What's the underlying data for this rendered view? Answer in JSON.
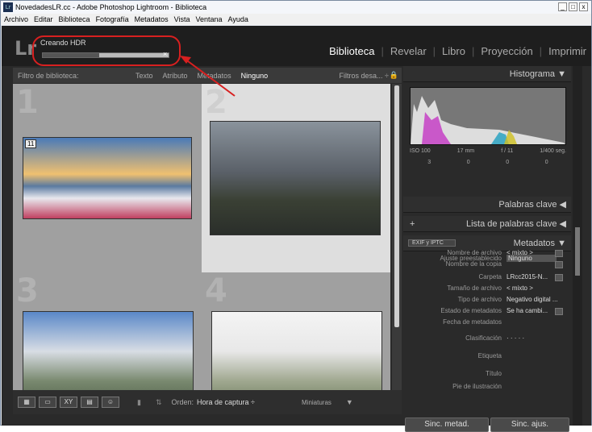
{
  "window": {
    "title": "NovedadesLR.cc - Adobe Photoshop Lightroom - Biblioteca",
    "icon": "Lr",
    "controls": [
      "_",
      "□",
      "x"
    ]
  },
  "menu": [
    "Archivo",
    "Editar",
    "Biblioteca",
    "Fotografía",
    "Metadatos",
    "Vista",
    "Ventana",
    "Ayuda"
  ],
  "logo": "Lr",
  "progress": {
    "label": "Creando HDR",
    "fraction": 0.45,
    "close": "×"
  },
  "modules": [
    "Biblioteca",
    "Revelar",
    "Libro",
    "Proyección",
    "Imprimir"
  ],
  "filter": {
    "label": "Filtro de biblioteca:",
    "items": [
      "Texto",
      "Atributo",
      "Metadatos",
      "Ninguno"
    ],
    "preset": "Filtros desa... ÷"
  },
  "grid": {
    "cells": [
      {
        "num": "1",
        "badge": "11"
      },
      {
        "num": "2",
        "badge": ""
      },
      {
        "num": "3",
        "badge": ""
      },
      {
        "num": "4",
        "badge": ""
      }
    ]
  },
  "toolbar": {
    "sort_label": "Orden:",
    "sort_value": "Hora de captura ÷",
    "thumb_label": "Miniaturas",
    "xy": "XY"
  },
  "panels": {
    "histogram": "Histograma",
    "iso": "ISO 100",
    "focal": "17 mm",
    "aperture": "f / 11",
    "shutter": "1/400 seg.",
    "counts": [
      "3",
      "0",
      "0",
      "0"
    ],
    "keywords": "Palabras clave",
    "keyword_list": "Lista de palabras clave",
    "plus": "+",
    "metadata": "Metadatos",
    "metadata_set": "EXIF y IPTC",
    "preset_label": "Ajuste preestablecido",
    "preset_value": "Ninguno",
    "fields": [
      {
        "k": "Nombre de archivo",
        "v": "< mixto >"
      },
      {
        "k": "Nombre de la copia",
        "v": ""
      },
      {
        "k": "Carpeta",
        "v": "LRcc2015-N..."
      },
      {
        "k": "Tamaño de archivo",
        "v": "< mixto >"
      },
      {
        "k": "Tipo de archivo",
        "v": "Negativo digital ..."
      },
      {
        "k": "Estado de metadatos",
        "v": "Se ha cambi..."
      },
      {
        "k": "Fecha de metadatos",
        "v": ""
      },
      {
        "k": "Clasificación",
        "v": "· · · · ·"
      },
      {
        "k": "Etiqueta",
        "v": ""
      },
      {
        "k": "Título",
        "v": ""
      },
      {
        "k": "Pie de ilustración",
        "v": ""
      }
    ],
    "sync_meta": "Sinc. metad.",
    "sync_set": "Sinc. ajus."
  }
}
